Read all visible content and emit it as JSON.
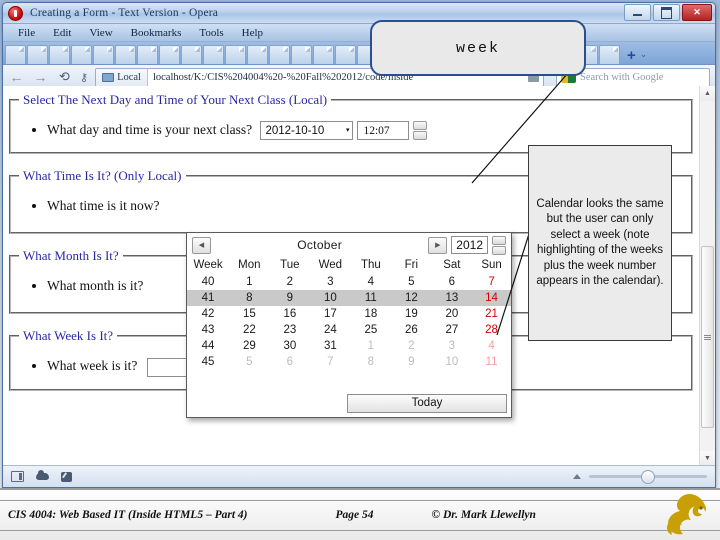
{
  "window": {
    "title": "Creating a Form - Text Version - Opera",
    "controls": {
      "minimize": "–",
      "maximize": "□",
      "close": "✕"
    }
  },
  "menubar": {
    "items": [
      "File",
      "Edit",
      "View",
      "Bookmarks",
      "Tools",
      "Help"
    ]
  },
  "tabbar": {
    "new_tab_label": "+",
    "chevron": "⌄",
    "tab_count": 28
  },
  "navbar": {
    "back": "←",
    "forward": "→",
    "reload": "⟳",
    "key_icon": "⚷",
    "local_badge": "Local",
    "url": "localhost/K:/CIS%204004%20-%20Fall%202012/code/inside",
    "search_placeholder": "Search with Google"
  },
  "tooltip": {
    "text": "week"
  },
  "callout": {
    "text": "Calendar looks the same but the user can only select a week (note highlighting of the weeks plus the week number appears in the calendar)."
  },
  "form": {
    "fieldsets": [
      {
        "legend": "Select The Next Day and Time of Your Next Class (Local)",
        "question": "What day and time is your next class?",
        "date_value": "2012-10-10",
        "time_value": "12:07",
        "caret": "▾"
      },
      {
        "legend": "What Time Is It? (Only Local)",
        "question": "What time is it now?"
      },
      {
        "legend": "What Month Is It?",
        "question": "What month is it?"
      },
      {
        "legend": "What Week Is It?",
        "question": "What week is it?",
        "week_value": "",
        "caret": "▾"
      }
    ]
  },
  "calendar": {
    "prev_arrow": "◀",
    "next_arrow": "▶",
    "month": "October",
    "year": "2012",
    "headers": [
      "Week",
      "Mon",
      "Tue",
      "Wed",
      "Thu",
      "Fri",
      "Sat",
      "Sun"
    ],
    "selected_week": "41",
    "today_label": "Today",
    "rows": [
      {
        "week": "40",
        "days": [
          {
            "n": "1",
            "out": false
          },
          {
            "n": "2",
            "out": false
          },
          {
            "n": "3",
            "out": false
          },
          {
            "n": "4",
            "out": false
          },
          {
            "n": "5",
            "out": false
          },
          {
            "n": "6",
            "out": false
          },
          {
            "n": "7",
            "out": false,
            "sun": true
          }
        ]
      },
      {
        "week": "41",
        "selected": true,
        "days": [
          {
            "n": "8",
            "out": false
          },
          {
            "n": "9",
            "out": false
          },
          {
            "n": "10",
            "out": false
          },
          {
            "n": "11",
            "out": false
          },
          {
            "n": "12",
            "out": false
          },
          {
            "n": "13",
            "out": false
          },
          {
            "n": "14",
            "out": false,
            "sun": true
          }
        ]
      },
      {
        "week": "42",
        "days": [
          {
            "n": "15",
            "out": false
          },
          {
            "n": "16",
            "out": false
          },
          {
            "n": "17",
            "out": false
          },
          {
            "n": "18",
            "out": false
          },
          {
            "n": "19",
            "out": false
          },
          {
            "n": "20",
            "out": false
          },
          {
            "n": "21",
            "out": false,
            "sun": true
          }
        ]
      },
      {
        "week": "43",
        "days": [
          {
            "n": "22",
            "out": false
          },
          {
            "n": "23",
            "out": false
          },
          {
            "n": "24",
            "out": false
          },
          {
            "n": "25",
            "out": false
          },
          {
            "n": "26",
            "out": false
          },
          {
            "n": "27",
            "out": false
          },
          {
            "n": "28",
            "out": false,
            "sun": true
          }
        ]
      },
      {
        "week": "44",
        "days": [
          {
            "n": "29",
            "out": false
          },
          {
            "n": "30",
            "out": false
          },
          {
            "n": "31",
            "out": false
          },
          {
            "n": "1",
            "out": true
          },
          {
            "n": "2",
            "out": true
          },
          {
            "n": "3",
            "out": true
          },
          {
            "n": "4",
            "out": true,
            "sun": true
          }
        ]
      },
      {
        "week": "45",
        "days": [
          {
            "n": "5",
            "out": true
          },
          {
            "n": "6",
            "out": true
          },
          {
            "n": "7",
            "out": true
          },
          {
            "n": "8",
            "out": true
          },
          {
            "n": "9",
            "out": true
          },
          {
            "n": "10",
            "out": true
          },
          {
            "n": "11",
            "out": true,
            "sun": true
          }
        ]
      }
    ]
  },
  "statusbar": {
    "icons": [
      "panel-icon",
      "cloud-icon",
      "note-icon"
    ],
    "zoom_marker": "▲"
  },
  "slide_footer": {
    "course": "CIS 4004: Web Based IT (Inside HTML5 – Part 4)",
    "page": "Page 54",
    "copyright": "© Dr. Mark Llewellyn"
  },
  "colors": {
    "legend_blue": "#2727a8",
    "sunday_red": "#d40000",
    "selected_row": "#c9c9c9",
    "ucf_gold": "#c8a005",
    "close_red": "#b32222"
  }
}
